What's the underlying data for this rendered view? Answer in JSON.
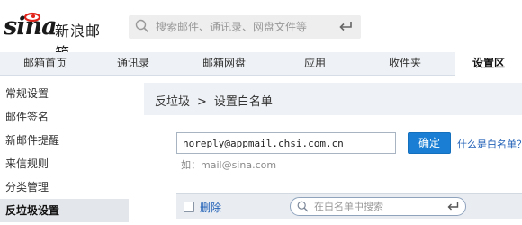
{
  "header": {
    "logo_text": "sina",
    "product_name": "新浪邮箱",
    "search_placeholder": "搜索邮件、通讯录、网盘文件等",
    "search_icon": "search-icon",
    "enter_icon": "enter-icon"
  },
  "nav": {
    "items": [
      {
        "label": "邮箱首页"
      },
      {
        "label": "通讯录"
      },
      {
        "label": "邮箱网盘"
      },
      {
        "label": "应用"
      },
      {
        "label": "收件夹"
      },
      {
        "label": "设置区"
      }
    ],
    "active": "设置区"
  },
  "sidebar": {
    "items": [
      {
        "label": "常规设置"
      },
      {
        "label": "邮件签名"
      },
      {
        "label": "新邮件提醒"
      },
      {
        "label": "来信规则"
      },
      {
        "label": "分类管理"
      },
      {
        "label": "反垃圾设置"
      }
    ],
    "active": "反垃圾设置"
  },
  "main": {
    "breadcrumb": {
      "parent": "反垃圾",
      "separator": ">",
      "current": "设置白名单"
    },
    "email_value": "noreply@appmail.chsi.com.cn",
    "confirm_label": "确定",
    "whatis_link": "什么是白名单？",
    "hint": "如：mail@sina.com",
    "delete_label": "删除",
    "whitelist_search_placeholder": "在白名单中搜索"
  },
  "colors": {
    "accent": "#1a7fd4",
    "link": "#2563b8",
    "nav_bg": "#eef1f5",
    "sidebar_active_bg": "#e3e6ea"
  }
}
